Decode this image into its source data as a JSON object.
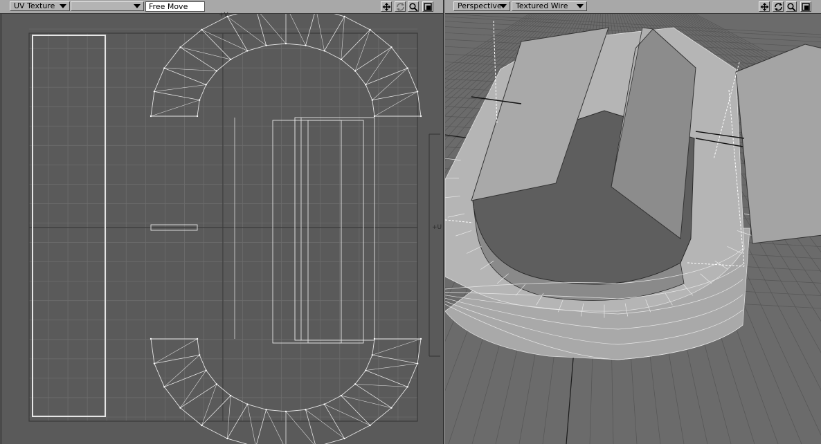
{
  "uv_view": {
    "view_mode": "UV Texture",
    "uv_map": "",
    "tool_field": "Free Move",
    "axis_v_label": "+V",
    "axis_u_label": "+U"
  },
  "perspective_view": {
    "view_mode": "Perspective",
    "render_mode": "Textured Wire"
  },
  "icons": [
    "move-icon",
    "rotate-icon",
    "zoom-icon",
    "maximize-icon"
  ],
  "colors": {
    "viewport_bg": "#5a5a5a",
    "toolbar_bg": "#a8a8a8",
    "wire": "#e6e6e6",
    "grid": "#6a6a6a",
    "surface": "#9a9a9a"
  }
}
